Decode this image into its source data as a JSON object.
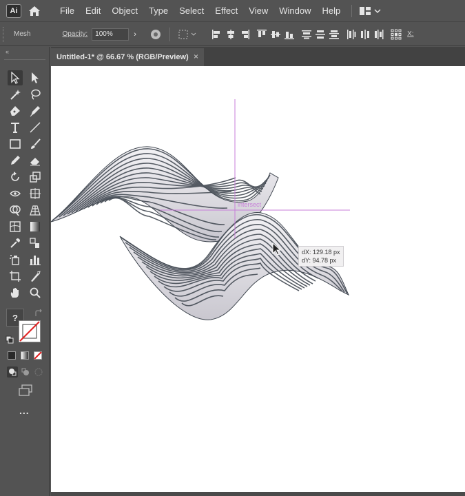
{
  "menubar": {
    "logo": "Ai",
    "items": [
      "File",
      "Edit",
      "Object",
      "Type",
      "Select",
      "Effect",
      "View",
      "Window",
      "Help"
    ]
  },
  "controlbar": {
    "selection_label": "Mesh",
    "opacity_label": "Opacity:",
    "opacity_value": "100%",
    "transform_x_label": "X:"
  },
  "document": {
    "tab_title": "Untitled-1* @ 66.67 % (RGB/Preview)",
    "close": "×"
  },
  "canvas": {
    "smart_guide_label": "intersect",
    "tooltip_dx": "dX: 129.18 px",
    "tooltip_dy": "dY: 94.78 px"
  },
  "toolpanel": {
    "fill_stroke_unknown": "?",
    "more_tools": "..."
  },
  "colors": {
    "ui_bg": "#535353",
    "canvas_bg": "#ffffff",
    "smart_guide": "#c77dd8",
    "wave_stroke": "#454c55"
  }
}
